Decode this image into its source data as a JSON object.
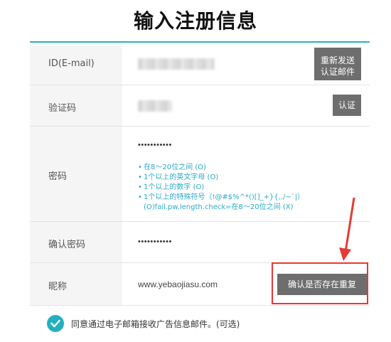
{
  "title": "输入注册信息",
  "rows": {
    "email": {
      "label": "ID(E-mail)",
      "button": "重新发送\n认证邮件"
    },
    "code": {
      "label": "验证码",
      "button": "认证"
    },
    "password": {
      "label": "密码",
      "value": "•••••••••••",
      "rules": [
        "在8～20位之间 (O)",
        "1个以上的英文字母 (O)",
        "1个以上的数字 (O)",
        "1个以上的特殊符号（!@#$%^*()[]_+}{,./~`|）",
        "(O)fail.pw.length.check=在8～20位之间 (X)"
      ]
    },
    "confirm": {
      "label": "确认密码",
      "value": "•••••••••••"
    },
    "nickname": {
      "label": "昵称",
      "value": "www.yebaojiasu.com",
      "help": "?",
      "button": "确认是否存在重复"
    }
  },
  "agree_text": "同意通过电子邮箱接收广告信息邮件。(可选)",
  "colors": {
    "accent": "#2bb3b1",
    "button": "#6e6e6e",
    "highlight": "#e53935",
    "rule_text": "#2ba9c9"
  }
}
